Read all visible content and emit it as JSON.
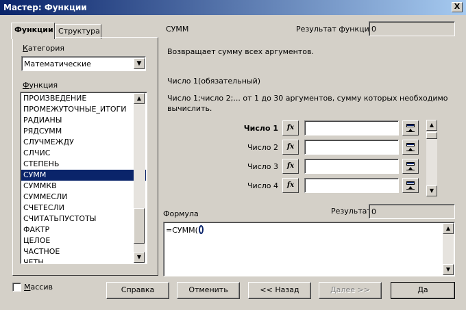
{
  "window": {
    "title": "Мастер: Функции",
    "close": "X"
  },
  "tabs": [
    {
      "label": "Функции",
      "active": true
    },
    {
      "label": "Структура",
      "active": false
    }
  ],
  "category": {
    "label": "Категория",
    "value": "Математические"
  },
  "functions": {
    "label": "Функция",
    "items": [
      "ПРОИЗВЕДЕНИЕ",
      "ПРОМЕЖУТОЧНЫЕ_ИТОГИ",
      "РАДИАНЫ",
      "РЯДСУММ",
      "СЛУЧМЕЖДУ",
      "СЛЧИС",
      "СТЕПЕНЬ",
      "СУММ",
      "СУММКВ",
      "СУММЕСЛИ",
      "СЧЕТЕСЛИ",
      "СЧИТАТЬПУСТОТЫ",
      "ФАКТР",
      "ЦЕЛОЕ",
      "ЧАСТНОЕ",
      "ЧЕТН"
    ],
    "selected": "СУММ"
  },
  "func_info": {
    "name": "СУММ",
    "result_label": "Результат функции",
    "result_value": "0",
    "description": "Возвращает сумму всех аргументов.",
    "arg_title": "Число 1(обязательный)",
    "arg_desc_line1": "Число 1;число 2;... от 1 до 30 аргументов, сумму которых необходимо",
    "arg_desc_line2": "вычислить."
  },
  "args": [
    {
      "label": "Число 1",
      "value": "",
      "bold": true
    },
    {
      "label": "Число 2",
      "value": "",
      "bold": false
    },
    {
      "label": "Число 3",
      "value": "",
      "bold": false
    },
    {
      "label": "Число 4",
      "value": "",
      "bold": false
    }
  ],
  "fx_label": "fx",
  "formula": {
    "label": "Формула",
    "value": "=СУММ(",
    "close_paren": ")",
    "result_label": "Результат",
    "result_value": "0"
  },
  "array": {
    "label": "Массив",
    "checked": false
  },
  "buttons": {
    "help": "Справка",
    "cancel": "Отменить",
    "back": "<< Назад",
    "next": "Далее >>",
    "ok": "Да"
  }
}
